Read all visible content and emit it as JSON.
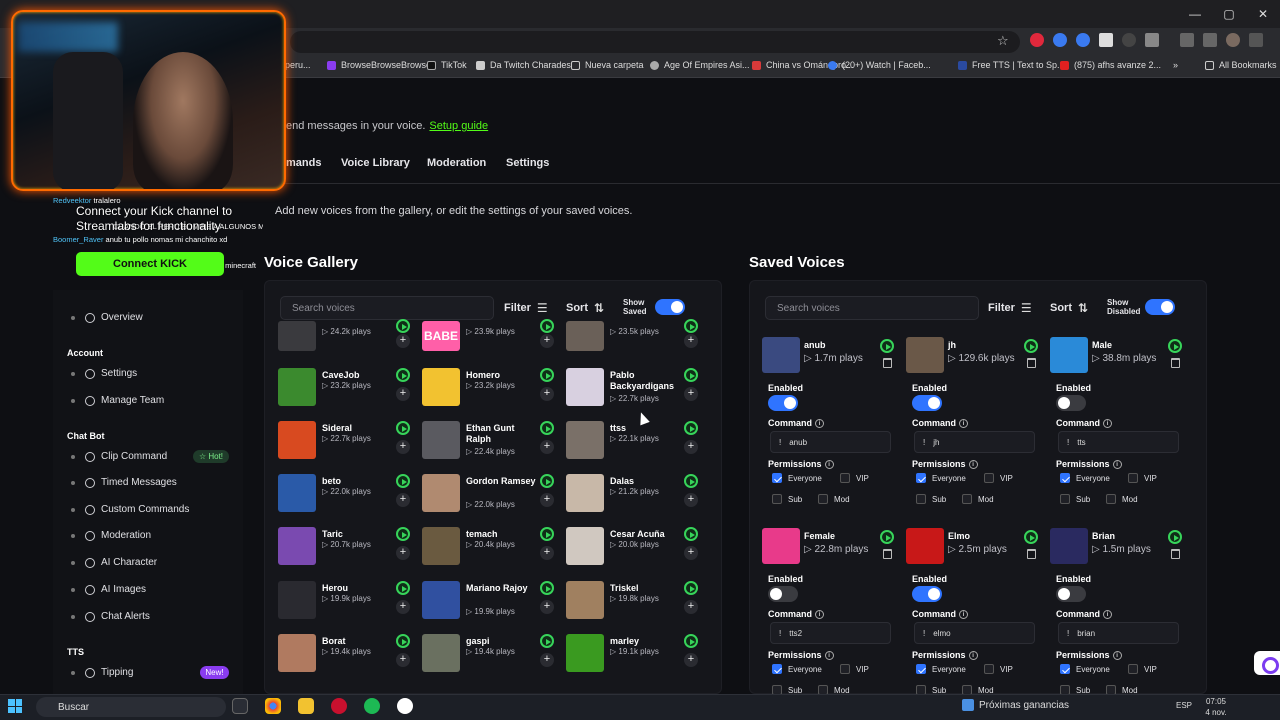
{
  "browser": {
    "window_controls": [
      "—",
      "▢",
      "✕"
    ],
    "bookmarks": [
      {
        "label": "#peru..."
      },
      {
        "label": "BrowseBrowseBrowse"
      },
      {
        "label": "TikTok"
      },
      {
        "label": "Da Twitch Charades"
      },
      {
        "label": "Nueva carpeta"
      },
      {
        "label": "Age Of Empires Asi..."
      },
      {
        "label": "China vs Omán: pro..."
      },
      {
        "label": "(20+) Watch | Faceb..."
      },
      {
        "label": "Free TTS | Text to Sp..."
      },
      {
        "label": "(875) afhs avanze 2..."
      },
      {
        "label": "All Bookmarks"
      }
    ]
  },
  "stream_overlay": {
    "chat": [
      {
        "user": "Redveektor",
        "text": "tralalero"
      },
      {
        "user": "Boomer_Raver",
        "text": "anub tu pollo nomas mi chanchito xd"
      },
      {
        "user": "",
        "text": "CUANDO EL PERU ELIMINE A ALGUNOS MAS"
      },
      {
        "user": "",
        "text": "echemos 20000 a la leerda comprenme el minecraft"
      }
    ],
    "kick_prompt": "Connect your Kick channel to Streamlabs for functionality",
    "kick_button": "Connect KICK"
  },
  "sidebar": {
    "overview": "Overview",
    "account_heading": "Account",
    "settings": "Settings",
    "manage_team": "Manage Team",
    "chatbot_heading": "Chat Bot",
    "clip_command": "Clip Command",
    "hot_badge": "☆ Hot!",
    "timed_messages": "Timed Messages",
    "custom_commands": "Custom Commands",
    "moderation": "Moderation",
    "ai_character": "AI Character",
    "ai_images": "AI Images",
    "chat_alerts": "Chat Alerts",
    "tts_heading": "TTS",
    "tipping": "Tipping",
    "new_badge": "New!"
  },
  "header": {
    "setup_text": "end messages in your voice.",
    "setup_link": "Setup guide",
    "tabs": [
      "mands",
      "Voice Library",
      "Moderation",
      "Settings"
    ],
    "subtitle": "Add new voices from the gallery, or edit the settings of your saved voices."
  },
  "gallery": {
    "title": "Voice Gallery",
    "search_placeholder": "Search voices",
    "filter": "Filter",
    "sort": "Sort",
    "show_label_1": "Show",
    "show_label_2": "Saved",
    "show_saved_on": true,
    "voices": [
      {
        "name": "",
        "plays": "▷ 24.2k plays",
        "color": "#3a3a3e"
      },
      {
        "name": "",
        "plays": "▷ 23.9k plays",
        "color": "#ff5fa8",
        "thumb_text": "BABE"
      },
      {
        "name": "",
        "plays": "▷ 23.5k plays",
        "color": "#6a6058"
      },
      {
        "name": "CaveJob",
        "plays": "▷ 23.2k plays",
        "color": "#3b8a2e"
      },
      {
        "name": "Homero",
        "plays": "▷ 23.2k plays",
        "color": "#f2c230"
      },
      {
        "name": "Pablo Backyardigans",
        "plays": "▷ 22.7k plays",
        "color": "#d8d0e0"
      },
      {
        "name": "Sideral",
        "plays": "▷ 22.7k plays",
        "color": "#d84a20"
      },
      {
        "name": "Ethan Gunt Ralph",
        "plays": "▷ 22.4k plays",
        "color": "#5a5a60"
      },
      {
        "name": "ttss",
        "plays": "▷ 22.1k plays",
        "color": "#7a7068"
      },
      {
        "name": "beto",
        "plays": "▷ 22.0k plays",
        "color": "#2a5aa8"
      },
      {
        "name": "Gordon Ramsey",
        "plays": "▷ 22.0k plays",
        "color": "#b08a70"
      },
      {
        "name": "Dalas",
        "plays": "▷ 21.2k plays",
        "color": "#c8b8a8"
      },
      {
        "name": "Taric",
        "plays": "▷ 20.7k plays",
        "color": "#7a4ab0"
      },
      {
        "name": "temach",
        "plays": "▷ 20.4k plays",
        "color": "#6a5a40"
      },
      {
        "name": "Cesar Acuña",
        "plays": "▷ 20.0k plays",
        "color": "#d0c8c0"
      },
      {
        "name": "Herou",
        "plays": "▷ 19.9k plays",
        "color": "#2a2a30"
      },
      {
        "name": "Mariano Rajoy",
        "plays": "▷ 19.9k plays",
        "color": "#3050a0"
      },
      {
        "name": "Triskel",
        "plays": "▷ 19.8k plays",
        "color": "#a08060"
      },
      {
        "name": "Borat",
        "plays": "▷ 19.4k plays",
        "color": "#b07a60"
      },
      {
        "name": "gaspi",
        "plays": "▷ 19.4k plays",
        "color": "#6a7060"
      },
      {
        "name": "marley",
        "plays": "▷ 19.1k plays",
        "color": "#3a9a20"
      }
    ]
  },
  "saved": {
    "title": "Saved Voices",
    "search_placeholder": "Search voices",
    "filter": "Filter",
    "sort": "Sort",
    "show_label_1": "Show",
    "show_label_2": "Disabled",
    "show_disabled_on": true,
    "enabled_label": "Enabled",
    "command_label": "Command",
    "permissions_label": "Permissions",
    "everyone": "Everyone",
    "vip": "VIP",
    "sub": "Sub",
    "mod": "Mod",
    "voices": [
      {
        "name": "anub",
        "plays": "▷ 1.7m plays",
        "enabled": true,
        "command": "anub",
        "color": "#3a4a80"
      },
      {
        "name": "jh",
        "plays": "▷ 129.6k plays",
        "enabled": true,
        "command": "jh",
        "color": "#6a5848"
      },
      {
        "name": "Male",
        "plays": "▷ 38.8m plays",
        "enabled": false,
        "command": "tts",
        "color": "#2a8ad8"
      },
      {
        "name": "Female",
        "plays": "▷ 22.8m plays",
        "enabled": false,
        "command": "tts2",
        "color": "#e83a8a"
      },
      {
        "name": "Elmo",
        "plays": "▷ 2.5m plays",
        "enabled": true,
        "command": "elmo",
        "color": "#c81818"
      },
      {
        "name": "Brian",
        "plays": "▷ 1.5m plays",
        "enabled": false,
        "command": "brian",
        "color": "#2a2a60"
      }
    ]
  },
  "taskbar": {
    "search": "Buscar",
    "news": "Próximas ganancias",
    "lang": "ESP",
    "time": "07:05",
    "date": "4 nov. 2025"
  }
}
